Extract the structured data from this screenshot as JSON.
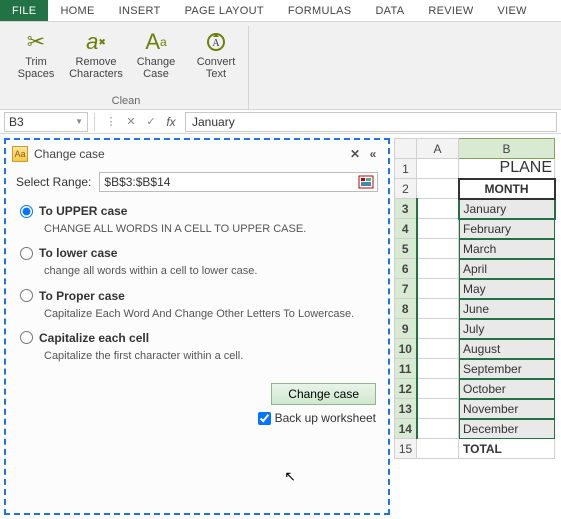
{
  "tabs": {
    "file": "FILE",
    "home": "HOME",
    "insert": "INSERT",
    "page_layout": "PAGE LAYOUT",
    "formulas": "FORMULAS",
    "data": "DATA",
    "review": "REVIEW",
    "view": "VIEW"
  },
  "ribbon_group": {
    "label": "Clean",
    "trim": "Trim Spaces",
    "remove": "Remove Characters",
    "change": "Change Case",
    "convert": "Convert Text"
  },
  "fbar": {
    "name_box": "B3",
    "formula": "January",
    "fx": "fx"
  },
  "pane": {
    "title": "Change case",
    "select_label": "Select Range:",
    "range": "$B$3:$B$14",
    "opt_upper": {
      "title": "To UPPER case",
      "desc": "CHANGE ALL WORDS IN A CELL TO UPPER CASE."
    },
    "opt_lower": {
      "title": "To lower case",
      "desc": "change all words within a cell to lower case."
    },
    "opt_proper": {
      "title": "To Proper case",
      "desc": "Capitalize Each Word And Change Other Letters To Lowercase."
    },
    "opt_cap": {
      "title": "Capitalize each cell",
      "desc": "Capitalize the first character within a cell."
    },
    "button": "Change case",
    "backup": "Back up worksheet"
  },
  "cols": {
    "A": "A",
    "B": "B"
  },
  "rows": {
    "r1": {
      "num": "1",
      "b": "PLANE"
    },
    "r2": {
      "num": "2",
      "b": "MONTH"
    },
    "r3": {
      "num": "3",
      "b": "January"
    },
    "r4": {
      "num": "4",
      "b": "February"
    },
    "r5": {
      "num": "5",
      "b": "March"
    },
    "r6": {
      "num": "6",
      "b": "April"
    },
    "r7": {
      "num": "7",
      "b": "May"
    },
    "r8": {
      "num": "8",
      "b": "June"
    },
    "r9": {
      "num": "9",
      "b": "July"
    },
    "r10": {
      "num": "10",
      "b": "August"
    },
    "r11": {
      "num": "11",
      "b": "September"
    },
    "r12": {
      "num": "12",
      "b": "October"
    },
    "r13": {
      "num": "13",
      "b": "November"
    },
    "r14": {
      "num": "14",
      "b": "December"
    },
    "r15": {
      "num": "15",
      "b": "TOTAL"
    }
  }
}
